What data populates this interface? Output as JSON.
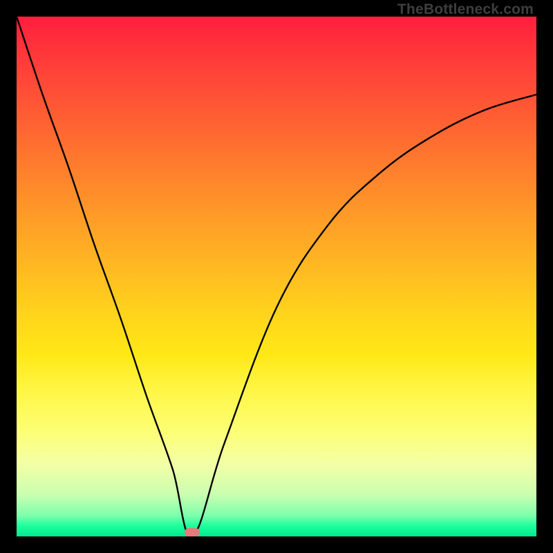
{
  "watermark_text": "TheBottleneck.com",
  "chart_data": {
    "type": "line",
    "title": "",
    "xlabel": "",
    "ylabel": "",
    "xlim": [
      0,
      100
    ],
    "ylim": [
      0,
      100
    ],
    "grid": false,
    "legend": false,
    "background": "red-yellow-green vertical gradient (high values red, low values green)",
    "series": [
      {
        "name": "bottleneck-curve",
        "x": [
          0,
          5,
          10,
          15,
          20,
          25,
          30,
          33.8,
          40,
          50,
          60,
          70,
          80,
          90,
          100
        ],
        "values": [
          100,
          85,
          71,
          56,
          42,
          27,
          13,
          0,
          18,
          44,
          60,
          70,
          77,
          82,
          85
        ]
      }
    ],
    "annotations": [
      {
        "name": "optimal-marker",
        "shape": "rounded-rect",
        "x": 33.8,
        "y": 0.8,
        "color": "#e47a7a"
      }
    ]
  }
}
